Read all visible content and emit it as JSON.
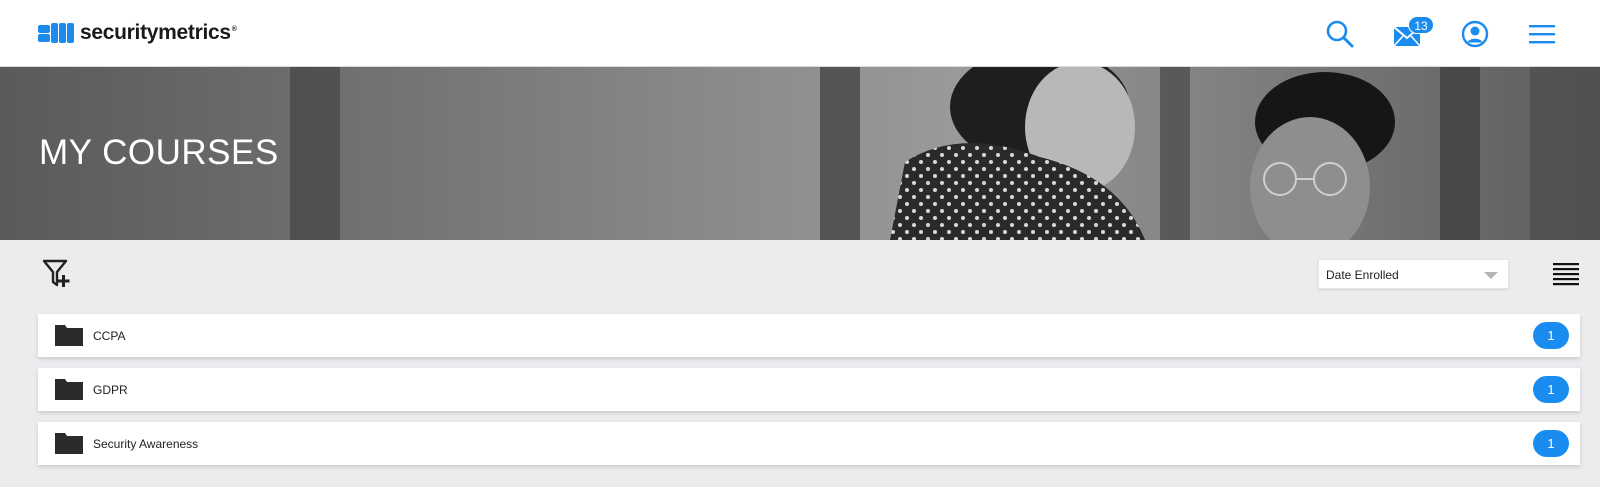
{
  "header": {
    "logo_text": "securitymetrics",
    "logo_reg": "®",
    "mail_count": "13",
    "icons": [
      "search-icon",
      "mail-icon",
      "account-icon",
      "menu-icon"
    ],
    "accent_color": "#1a8cf0"
  },
  "banner": {
    "title": "MY COURSES"
  },
  "toolbar": {
    "filter_icon": "filter-add-icon",
    "sort_selected": "Date Enrolled",
    "view_icon": "list-view-icon"
  },
  "courses": [
    {
      "name": "CCPA",
      "count": "1"
    },
    {
      "name": "GDPR",
      "count": "1"
    },
    {
      "name": "Security Awareness",
      "count": "1"
    }
  ]
}
